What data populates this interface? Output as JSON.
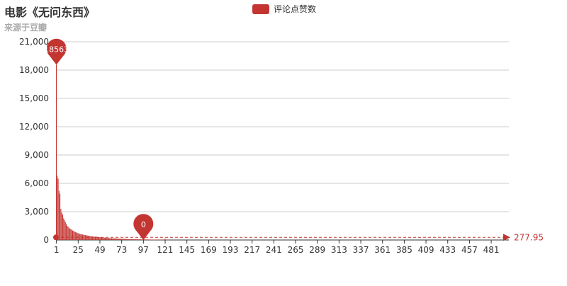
{
  "colors": {
    "series": "#c23531",
    "axis_text": "#333333",
    "grid": "#cccccc",
    "title": "#333333",
    "subtitle": "#aaaaaa"
  },
  "chart_data": {
    "type": "bar",
    "title": "电影《无问东西》",
    "subtitle": "来源于豆瓣",
    "legend": {
      "position": "top-center",
      "entries": [
        "评论点赞数"
      ]
    },
    "x": {
      "min": 1,
      "max": 500,
      "tick_labels": [
        "1",
        "25",
        "49",
        "73",
        "97",
        "121",
        "145",
        "169",
        "193",
        "217",
        "241",
        "265",
        "289",
        "313",
        "337",
        "361",
        "385",
        "409",
        "433",
        "457",
        "481"
      ]
    },
    "y": {
      "min": 0,
      "max": 21000,
      "ticks": [
        0,
        3000,
        6000,
        9000,
        12000,
        15000,
        18000,
        21000
      ],
      "tick_labels": [
        "0",
        "3,000",
        "6,000",
        "9,000",
        "12,000",
        "15,000",
        "18,000",
        "21,000"
      ]
    },
    "grid": true,
    "series": [
      {
        "name": "评论点赞数",
        "values": [
          18563,
          6800,
          6500,
          5200,
          4900,
          3300,
          2900,
          2700,
          2300,
          2100,
          1900,
          1700,
          1500,
          1400,
          1300,
          1200,
          1150,
          1100,
          1000,
          950,
          900,
          850,
          800,
          760,
          720,
          680,
          650,
          620,
          600,
          580,
          560,
          540,
          520,
          500,
          480,
          460,
          440,
          420,
          400,
          390,
          380,
          370,
          360,
          350,
          340,
          330,
          320,
          310,
          300,
          290,
          280,
          270,
          260,
          250,
          240,
          230,
          220,
          210,
          200,
          195,
          190,
          185,
          180,
          175,
          170,
          165,
          160,
          155,
          150,
          145,
          140,
          135,
          130,
          125,
          120,
          115,
          110,
          105,
          100,
          95,
          90,
          88,
          86,
          84,
          82,
          80,
          78,
          76,
          74,
          72,
          70,
          68,
          66,
          64,
          62,
          60,
          0,
          58,
          56,
          54,
          52,
          50,
          48,
          46,
          44,
          42,
          40,
          38,
          36,
          34,
          32,
          30,
          28,
          26,
          24,
          22,
          20,
          18,
          16,
          14,
          150,
          12,
          10,
          9,
          8,
          7,
          6,
          5,
          4,
          3,
          2,
          1
        ],
        "markpoints": [
          {
            "label": "18563",
            "index": 1,
            "value": 18563
          },
          {
            "label": "0",
            "index": 97,
            "value": 0
          }
        ],
        "markline": {
          "label": "277.95",
          "value": 277.95
        }
      }
    ]
  }
}
